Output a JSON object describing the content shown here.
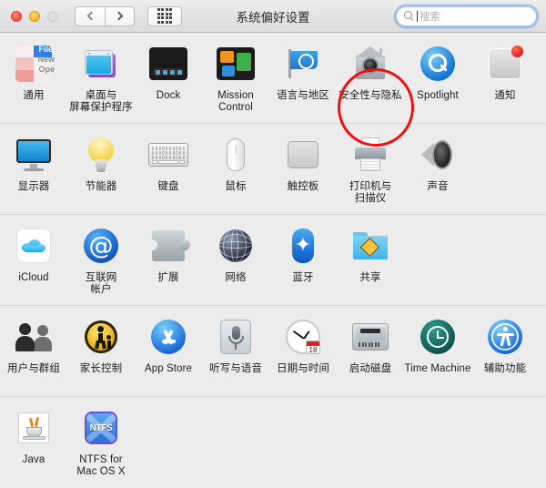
{
  "window": {
    "title": "系统偏好设置"
  },
  "toolbar": {
    "close_label": "close",
    "minimize_label": "minimize",
    "zoom_label": "zoom",
    "back_label": "back",
    "forward_label": "forward",
    "showall_label": "show-all",
    "search": {
      "value": "",
      "placeholder": "搜索"
    }
  },
  "rows": [
    {
      "items": [
        {
          "label": "通用",
          "icon": "general-icon",
          "tiles": [
            "File",
            "New",
            "Ope"
          ]
        },
        {
          "label": "桌面与\n屏幕保护程序",
          "icon": "desktop-screensaver-icon"
        },
        {
          "label": "Dock",
          "icon": "dock-icon"
        },
        {
          "label": "Mission\nControl",
          "icon": "mission-control-icon"
        },
        {
          "label": "语言与地区",
          "icon": "language-region-icon"
        },
        {
          "label": "安全性与隐私",
          "icon": "security-privacy-icon",
          "highlighted": true
        },
        {
          "label": "Spotlight",
          "icon": "spotlight-icon"
        },
        {
          "label": "通知",
          "icon": "notifications-icon"
        }
      ]
    },
    {
      "items": [
        {
          "label": "显示器",
          "icon": "displays-icon"
        },
        {
          "label": "节能器",
          "icon": "energy-saver-icon"
        },
        {
          "label": "键盘",
          "icon": "keyboard-icon"
        },
        {
          "label": "鼠标",
          "icon": "mouse-icon"
        },
        {
          "label": "触控板",
          "icon": "trackpad-icon"
        },
        {
          "label": "打印机与\n扫描仪",
          "icon": "printers-scanners-icon"
        },
        {
          "label": "声音",
          "icon": "sound-icon"
        }
      ]
    },
    {
      "items": [
        {
          "label": "iCloud",
          "icon": "icloud-icon"
        },
        {
          "label": "互联网\n帐户",
          "icon": "internet-accounts-icon"
        },
        {
          "label": "扩展",
          "icon": "extensions-icon"
        },
        {
          "label": "网络",
          "icon": "network-icon"
        },
        {
          "label": "蓝牙",
          "icon": "bluetooth-icon"
        },
        {
          "label": "共享",
          "icon": "sharing-icon"
        }
      ]
    },
    {
      "items": [
        {
          "label": "用户与群组",
          "icon": "users-groups-icon"
        },
        {
          "label": "家长控制",
          "icon": "parental-controls-icon"
        },
        {
          "label": "App Store",
          "icon": "app-store-icon"
        },
        {
          "label": "听写与语音",
          "icon": "dictation-speech-icon"
        },
        {
          "label": "日期与时间",
          "icon": "date-time-icon",
          "badge": "18"
        },
        {
          "label": "启动磁盘",
          "icon": "startup-disk-icon"
        },
        {
          "label": "Time Machine",
          "icon": "time-machine-icon"
        },
        {
          "label": "辅助功能",
          "icon": "accessibility-icon"
        }
      ]
    },
    {
      "items": [
        {
          "label": "Java",
          "icon": "java-icon"
        },
        {
          "label": "NTFS for\nMac OS X",
          "icon": "ntfs-for-mac-os-x-icon",
          "badge_text": "NTFS"
        }
      ]
    }
  ],
  "annotation": {
    "type": "circle-highlight",
    "target_label": "安全性与隐私",
    "color": "#ee1111"
  }
}
